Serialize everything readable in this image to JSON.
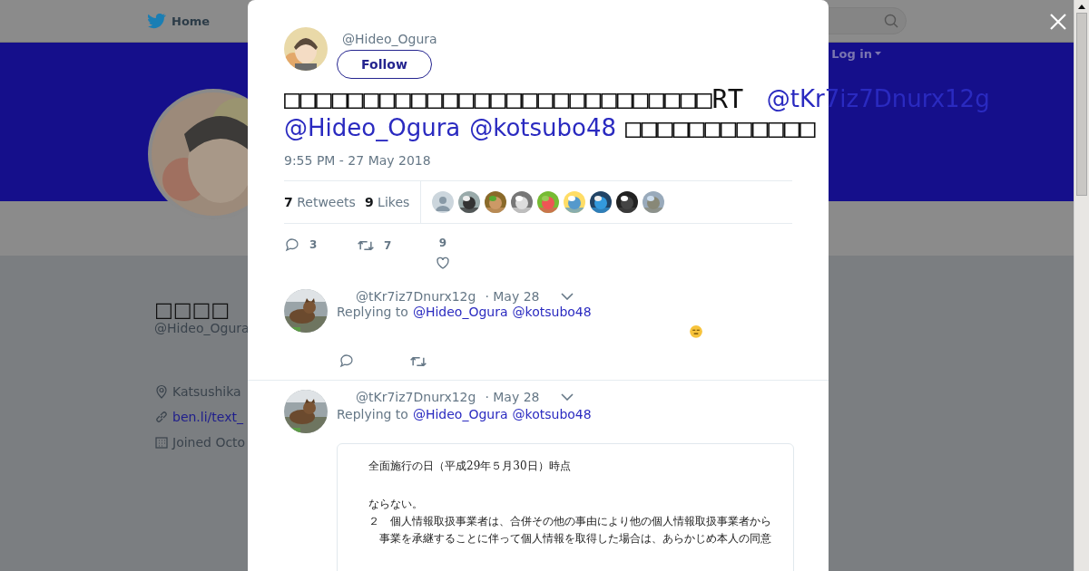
{
  "nav": {
    "home_label": "Home",
    "login_label": "Log in"
  },
  "profile": {
    "name": "□□□□",
    "handle": "@Hideo_Ogura",
    "location": "Katsushika",
    "link": "ben.li/text_",
    "joined": "Joined Octo"
  },
  "tweet": {
    "handle": "@Hideo_Ogura",
    "follow_label": "Follow",
    "lines": [
      [
        {
          "kind": "text",
          "text": "□□□□□□□□□□□□□□□□□□□□□□□□□□□RT "
        },
        {
          "kind": "mention",
          "text": "@tKr7iz7Dnurx12g"
        }
      ],
      [
        {
          "kind": "mention",
          "text": "@Hideo_Ogura"
        },
        {
          "kind": "mention",
          "text": "@kotsubo48"
        },
        {
          "kind": "text",
          "text": "□□□□□□□□□□□□"
        }
      ]
    ],
    "time": "9:55 PM - 27 May 2018",
    "retweets": {
      "count": "7",
      "label": "Retweets"
    },
    "likes": {
      "count": "9",
      "label": "Likes"
    },
    "liker_avatars": [
      {
        "kind": "default"
      },
      {
        "kind": "picture"
      },
      {
        "kind": "picture"
      },
      {
        "kind": "picture"
      },
      {
        "kind": "picture"
      },
      {
        "kind": "picture"
      },
      {
        "kind": "picture"
      },
      {
        "kind": "picture"
      },
      {
        "kind": "picture"
      }
    ],
    "actions": {
      "replies": "3",
      "retweets": "7",
      "likes": "9"
    }
  },
  "replies": [
    {
      "handle": "@tKr7iz7Dnurx12g",
      "date": "· May 28",
      "replying_label": "Replying to",
      "mentions": [
        "@Hideo_Ogura",
        "@kotsubo48"
      ],
      "attachment": {
        "kind": "emoji"
      }
    },
    {
      "handle": "@tKr7iz7Dnurx12g",
      "date": "· May 28",
      "replying_label": "Replying to",
      "mentions": [
        "@Hideo_Ogura",
        "@kotsubo48"
      ],
      "attachment": {
        "kind": "document",
        "heading": "全面施行の日（平成29年５月30日）時点",
        "lines": [
          "ならない。",
          "２　個人情報取扱事業者は、合併その他の事由により他の個人情報取扱事業者から",
          "　事業を承継することに伴って個人情報を取得した場合は、あらかじめ本人の同意"
        ]
      }
    }
  ]
}
